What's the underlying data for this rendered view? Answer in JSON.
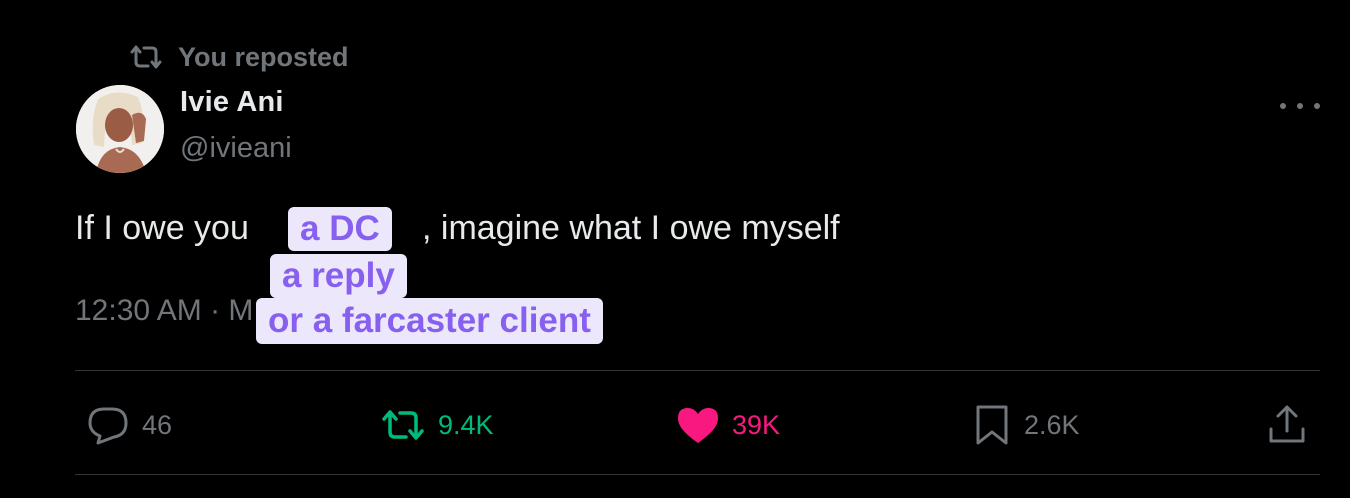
{
  "repost_header": {
    "label": "You reposted",
    "icon": "repost-icon"
  },
  "author": {
    "name": "Ivie Ani",
    "handle": "@ivieani",
    "avatar": "avatar"
  },
  "tweet": {
    "text_before": "If I owe you",
    "text_after": ", imagine what I owe myself",
    "timestamp": "12:30 AM · M"
  },
  "highlights": [
    "a DC",
    "a reply",
    "or a farcaster client"
  ],
  "actions": {
    "reply": {
      "count": "46",
      "icon": "reply-icon"
    },
    "repost": {
      "count": "9.4K",
      "icon": "repost-icon"
    },
    "like": {
      "count": "39K",
      "icon": "heart-icon"
    },
    "bookmark": {
      "count": "2.6K",
      "icon": "bookmark-icon"
    },
    "share": {
      "icon": "share-icon"
    }
  },
  "colors": {
    "background": "#000000",
    "muted": "#71767b",
    "repost_active": "#00ba7c",
    "like_active": "#f91880",
    "highlight_bg": "#ece7fb",
    "highlight_text": "#8760ef"
  }
}
